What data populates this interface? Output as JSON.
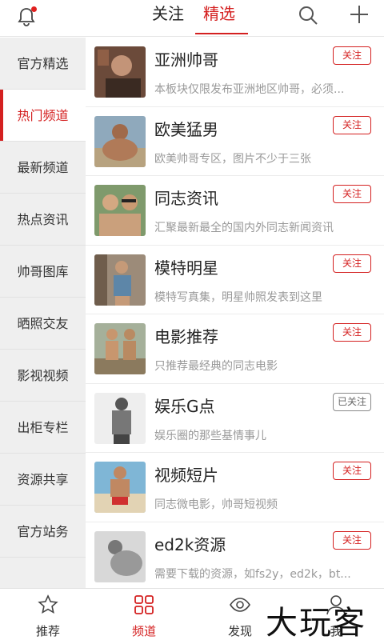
{
  "header": {
    "tabs": [
      {
        "label": "关注",
        "active": false
      },
      {
        "label": "精选",
        "active": true
      }
    ],
    "icons": [
      "bell-icon",
      "search-icon",
      "plus-icon"
    ],
    "accent": "#d42020"
  },
  "sidebar": {
    "items": [
      {
        "label": "官方精选"
      },
      {
        "label": "热门频道",
        "active": true
      },
      {
        "label": "最新频道"
      },
      {
        "label": "热点资讯"
      },
      {
        "label": "帅哥图库"
      },
      {
        "label": "晒照交友"
      },
      {
        "label": "影视视频"
      },
      {
        "label": "出柜专栏"
      },
      {
        "label": "资源共享"
      },
      {
        "label": "官方站务"
      }
    ]
  },
  "channels": [
    {
      "title": "亚洲帅哥",
      "desc": "本板块仅限发布亚洲地区帅哥，必须...",
      "button": "关注",
      "followed": false
    },
    {
      "title": "欧美猛男",
      "desc": "欧美帅哥专区，图片不少于三张",
      "button": "关注",
      "followed": false
    },
    {
      "title": "同志资讯",
      "desc": "汇聚最新最全的国内外同志新闻资讯",
      "button": "关注",
      "followed": false
    },
    {
      "title": "模特明星",
      "desc": "模特写真集，明星帅照发表到这里",
      "button": "关注",
      "followed": false
    },
    {
      "title": "电影推荐",
      "desc": "只推荐最经典的同志电影",
      "button": "关注",
      "followed": false
    },
    {
      "title": "娱乐G点",
      "desc": "娱乐圈的那些基情事儿",
      "button": "已关注",
      "followed": true
    },
    {
      "title": "视频短片",
      "desc": "同志微电影，帅哥短视频",
      "button": "关注",
      "followed": false
    },
    {
      "title": "ed2k资源",
      "desc": "需要下载的资源，如fs2y，ed2k，bt...",
      "button": "关注",
      "followed": false
    }
  ],
  "bottom_nav": [
    {
      "label": "推荐",
      "icon": "star-icon"
    },
    {
      "label": "频道",
      "icon": "grid-icon",
      "active": true
    },
    {
      "label": "发现",
      "icon": "eye-icon"
    },
    {
      "label": "我",
      "icon": "user-icon"
    }
  ],
  "watermark": "大玩客"
}
